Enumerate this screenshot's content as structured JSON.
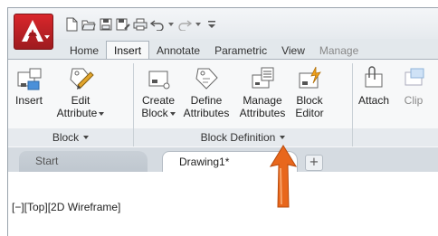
{
  "tabs": [
    "Home",
    "Insert",
    "Annotate",
    "Parametric",
    "View",
    "Manage"
  ],
  "active_tab": "Insert",
  "block_panel": {
    "title": "Block",
    "tools": [
      {
        "label_line1": "Insert",
        "label_line2": ""
      },
      {
        "label_line1": "Edit",
        "label_line2": "Attribute"
      }
    ]
  },
  "block_def_panel": {
    "title": "Block Definition",
    "tools": [
      {
        "label_line1": "Create",
        "label_line2": "Block"
      },
      {
        "label_line1": "Define",
        "label_line2": "Attributes"
      },
      {
        "label_line1": "Manage",
        "label_line2": "Attributes"
      },
      {
        "label_line1": "Block",
        "label_line2": "Editor"
      }
    ]
  },
  "reference_panel": {
    "tools": [
      {
        "label_line1": "Attach"
      },
      {
        "label_line1": "Clip"
      }
    ]
  },
  "doc_tabs": {
    "start": "Start",
    "drawing": "Drawing1*",
    "close": "×",
    "add": "+"
  },
  "viewport_label": "[−][Top][2D Wireframe]",
  "colors": {
    "app_red": "#c8242a",
    "callout_orange": "#e8671c"
  }
}
